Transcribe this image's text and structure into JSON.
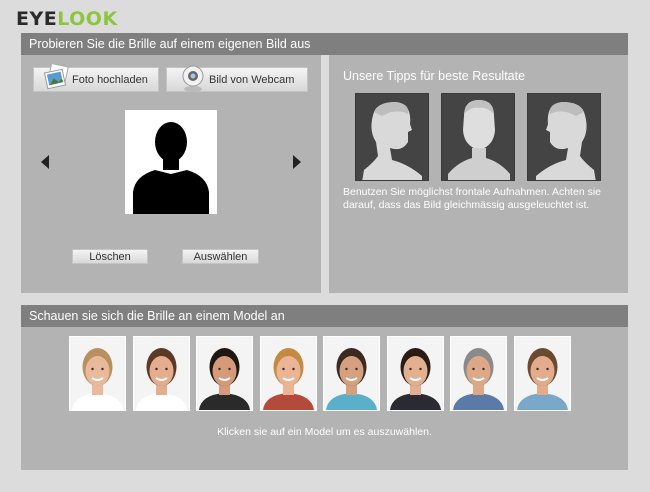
{
  "brand": {
    "part1": "EYE",
    "part2": "LOOK"
  },
  "upload_panel": {
    "title": "Probieren Sie die Brille auf einem eigenen Bild aus",
    "upload_button": "Foto hochladen",
    "webcam_button": "Bild von Webcam",
    "delete_button": "Löschen",
    "select_button": "Auswählen",
    "tips_title": "Unsere Tipps für beste Resultate",
    "tips_text": "Benutzen Sie möglichst frontale Aufnahmen. Achten sie darauf, dass das Bild gleichmässig ausgeleuchtet ist."
  },
  "models_panel": {
    "title": "Schauen sie sich die Brille an einem Model an",
    "hint": "Klicken sie auf ein Model um es auszuwählen.",
    "models": [
      {
        "name": "model-1",
        "skin": "#e8b99a",
        "hair": "#b89060",
        "shirt": "#ffffff"
      },
      {
        "name": "model-2",
        "skin": "#e3ad8e",
        "hair": "#5a3a26",
        "shirt": "#ffffff"
      },
      {
        "name": "model-3",
        "skin": "#d49a7a",
        "hair": "#1f1712",
        "shirt": "#2a2a2a"
      },
      {
        "name": "model-4",
        "skin": "#eab495",
        "hair": "#c48a40",
        "shirt": "#b34a3a"
      },
      {
        "name": "model-5",
        "skin": "#d4a080",
        "hair": "#3a2a20",
        "shirt": "#5ab0c8"
      },
      {
        "name": "model-6",
        "skin": "#e2b090",
        "hair": "#2a1c14",
        "shirt": "#2a2a35"
      },
      {
        "name": "model-7",
        "skin": "#dca888",
        "hair": "#8a8a8a",
        "shirt": "#5a7aa8"
      },
      {
        "name": "model-8",
        "skin": "#e2ac8c",
        "hair": "#6a4a30",
        "shirt": "#7aa8c8"
      }
    ]
  },
  "colors": {
    "accent": "#8cc63f",
    "panel": "#b3b3b3",
    "header": "#7f7f7f"
  }
}
